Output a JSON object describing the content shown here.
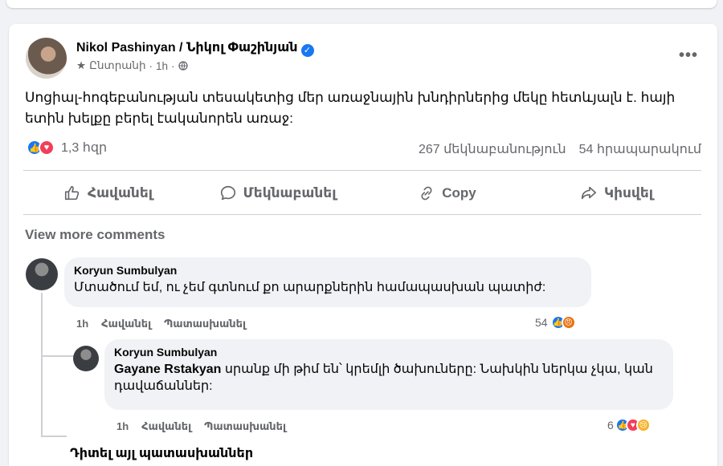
{
  "post": {
    "author": "Nikol Pashinyan / Նիկոլ Փաշինյան",
    "audience": "Ընտրանի",
    "time": "1h",
    "more": "•••",
    "text": "Սոցիալ-հոգեբանության տեսակետից մեր առաջնային խնդիրներից մեկը հետևյալն է. հայի ետին խելքը բերել էականորեն առաջ:",
    "reaction_count": "1,3 հզր",
    "comments_count": "267 մեկնաբանություն",
    "shares_count": "54 հրապարակում"
  },
  "actions": {
    "like": "Հավանել",
    "comment": "Մեկնաբանել",
    "copy": "Copy",
    "share": "Կիսվել"
  },
  "view_more_comments": "View more comments",
  "comments": [
    {
      "author": "Koryun Sumbulyan",
      "text": "Մտածում եմ, ու չեմ գտնում քո արարքներին համապասխան պատիժ:",
      "time": "1h",
      "like": "Հավանել",
      "reply": "Պատասխանել",
      "reaction_count": "54"
    },
    {
      "author": "Koryun Sumbulyan",
      "tag": "Gayane Rstakyan",
      "text": " սրանք մի թիմ են՝ կրեմլի ծախուները: Նախկին ներկա չկա, կան դավաճաններ:",
      "time": "1h",
      "like": "Հավանել",
      "reply": "Պատասխանել",
      "reaction_count": "6"
    }
  ],
  "see_other_replies": "Դիտել այլ պատասխաններ",
  "colors": {
    "accent": "#1877f2",
    "love": "#f33e58",
    "secondary_text": "#65676b",
    "bubble": "#f0f2f5"
  },
  "icons": [
    "verified-icon",
    "star-icon",
    "globe-icon",
    "like-reaction-icon",
    "love-reaction-icon",
    "angry-reaction-icon",
    "sad-reaction-icon",
    "thumbs-up-icon",
    "comment-icon",
    "link-icon",
    "share-icon"
  ]
}
